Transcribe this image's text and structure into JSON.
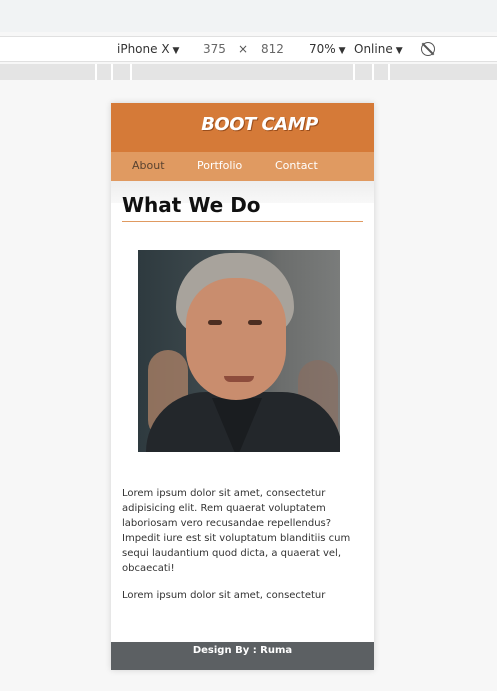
{
  "devtools": {
    "device": "iPhone X",
    "width": "375",
    "times": "×",
    "height": "812",
    "zoom": "70%",
    "throttle": "Online",
    "caret": "▼"
  },
  "site": {
    "logo": "BOOT CAMP",
    "nav": [
      "About",
      "Portfolio",
      "Contact"
    ],
    "section_title": "What We Do",
    "paragraphs": [
      "Lorem ipsum dolor sit amet, consectetur adipisicing elit. Rem quaerat voluptatem laboriosam vero recusandae repellendus? Impedit iure est sit voluptatum blanditiis cum sequi laudantium quod dicta, a quaerat vel, obcaecati!",
      "Lorem ipsum dolor sit amet, consectetur"
    ],
    "footer": "Design By : Ruma"
  },
  "colors": {
    "header": "#d57a38",
    "nav": "#e09a61",
    "footer": "#5c6063"
  }
}
